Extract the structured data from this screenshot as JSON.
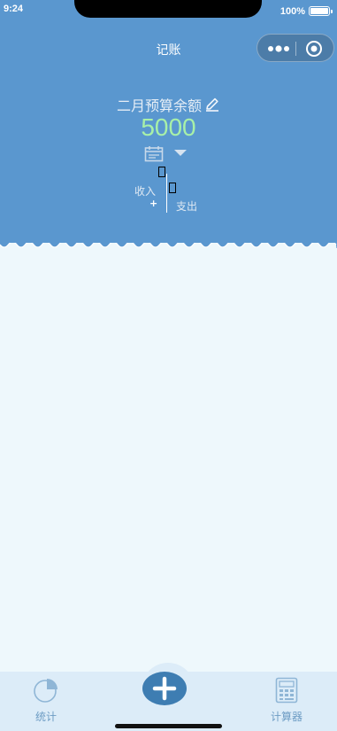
{
  "status_bar": {
    "time": "9:24",
    "battery": "100%"
  },
  "nav": {
    "title": "记账"
  },
  "capsule": {
    "more_icon": "more-dots-icon",
    "close_icon": "target-circle-icon"
  },
  "budget": {
    "label": "二月预算余额",
    "amount": "5000",
    "edit_icon": "pencil-icon"
  },
  "controls": {
    "calendar_icon": "calendar-icon",
    "dropdown_icon": "triangle-down-icon"
  },
  "summary": {
    "income_label": "收入",
    "expense_label": "支出",
    "plus": "+"
  },
  "tabs": {
    "stats": {
      "label": "统计",
      "icon": "pie-chart-icon"
    },
    "add": {
      "icon": "plus-icon"
    },
    "calculator": {
      "label": "计算器",
      "icon": "calculator-icon"
    }
  },
  "colors": {
    "header": "#5a97cf",
    "background": "#eef8fc",
    "amount": "#a8f0a8",
    "tab_bar": "#dcecf8",
    "add_button": "#3e7db2"
  }
}
